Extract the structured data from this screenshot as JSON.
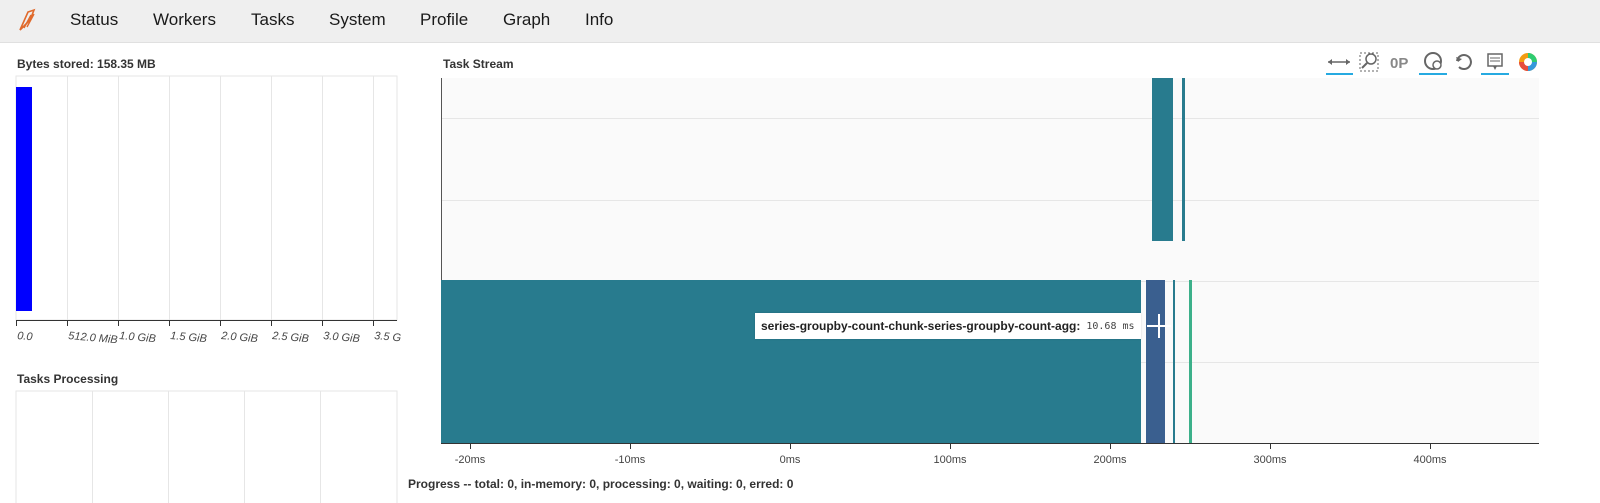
{
  "nav": {
    "items": [
      "Status",
      "Workers",
      "Tasks",
      "System",
      "Profile",
      "Graph",
      "Info"
    ]
  },
  "bytes_stored": {
    "title": "Bytes stored: 158.35 MB",
    "ticks": [
      "0.0",
      "512.0 MiB",
      "1.0 GiB",
      "1.5 GiB",
      "2.0 GiB",
      "2.5 GiB",
      "3.0 GiB",
      "3.5 G"
    ]
  },
  "tasks_processing": {
    "title": "Tasks Processing"
  },
  "task_stream": {
    "title": "Task Stream",
    "x_ticks": [
      "-20ms",
      "-10ms",
      "0ms",
      "100ms",
      "200ms",
      "300ms",
      "400ms"
    ],
    "tooltip": {
      "name": "series-groupby-count-chunk-series-groupby-count-agg:",
      "time": "10.68 ms"
    },
    "toolbar": [
      "pan-icon",
      "box-zoom-icon",
      "wheel-zoom-icon",
      "zoom-in-icon",
      "reset-icon",
      "hover-icon",
      "bokeh-logo-icon"
    ]
  },
  "progress": {
    "text": "Progress -- total: 0, in-memory: 0, processing: 0, waiting: 0, erred: 0"
  },
  "colors": {
    "bar_blue": "#0000ff",
    "task_teal": "#287b8e",
    "task_navy": "#3a5f8f",
    "task_green": "#3cb08a",
    "toolbar_active": "#26aae1"
  }
}
